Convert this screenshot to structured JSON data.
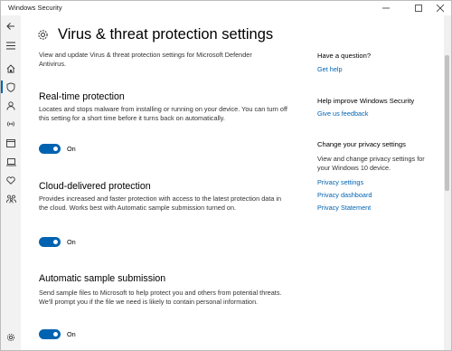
{
  "window": {
    "title": "Windows Security",
    "controls": [
      "minimize-icon",
      "maximize-icon",
      "close-icon"
    ]
  },
  "nav": {
    "items": [
      {
        "name": "back-arrow-icon"
      },
      {
        "name": "hamburger-menu-icon"
      },
      {
        "name": "home-icon"
      },
      {
        "name": "shield-icon",
        "active": true
      },
      {
        "name": "person-icon"
      },
      {
        "name": "wifi-antenna-icon"
      },
      {
        "name": "app-browser-window-icon"
      },
      {
        "name": "laptop-icon"
      },
      {
        "name": "heart-icon"
      },
      {
        "name": "family-icon"
      },
      {
        "name": "gear-icon"
      }
    ]
  },
  "page": {
    "title": "Virus & threat protection settings",
    "description": "View and update Virus & threat protection settings for Microsoft Defender Antivirus.",
    "header_icon": "gear-icon"
  },
  "sections": [
    {
      "title": "Real-time protection",
      "description": "Locates and stops malware from installing or running on your device. You can turn off this setting for a short time before it turns back on automatically.",
      "toggle_state": "On"
    },
    {
      "title": "Cloud-delivered protection",
      "description": "Provides increased and faster protection with access to the latest protection data in the cloud. Works best with Automatic sample submission turned on.",
      "toggle_state": "On"
    },
    {
      "title": "Automatic sample submission",
      "description": "Send sample files to Microsoft to help protect you and others from potential threats. We'll prompt you if the file we need is likely to contain personal information.",
      "toggle_state": "On"
    }
  ],
  "sidebar": {
    "question_heading": "Have a question?",
    "get_help": "Get help",
    "improve_heading": "Help improve Windows Security",
    "feedback": "Give us feedback",
    "privacy_heading": "Change your privacy settings",
    "privacy_text": "View and change privacy settings for your Windows 10 device.",
    "privacy_settings": "Privacy settings",
    "privacy_dashboard": "Privacy dashboard",
    "privacy_statement": "Privacy Statement"
  },
  "colors": {
    "accent": "#0063b1",
    "rail_bg": "#f2f2f2",
    "text_secondary": "#333333"
  }
}
